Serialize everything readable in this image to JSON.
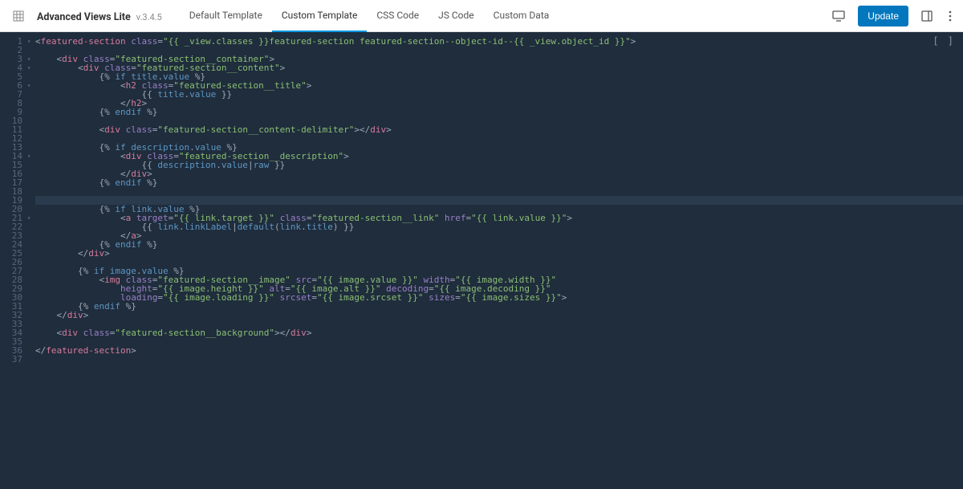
{
  "header": {
    "brand": "Advanced Views Lite",
    "version": "v.3.4.5",
    "update_label": "Update"
  },
  "tabs": [
    {
      "label": "Default Template",
      "active": false
    },
    {
      "label": "Custom Template",
      "active": true
    },
    {
      "label": "CSS Code",
      "active": false
    },
    {
      "label": "JS Code",
      "active": false
    },
    {
      "label": "Custom Data",
      "active": false
    }
  ],
  "editor": {
    "highlighted_line": 19,
    "brackets": "[ ]",
    "lines": [
      {
        "n": 1,
        "fold": "-",
        "tokens": [
          {
            "t": "tdel",
            "v": "<"
          },
          {
            "t": "tag",
            "v": "featured-section"
          },
          {
            "t": "",
            "v": " "
          },
          {
            "t": "attr",
            "v": "class"
          },
          {
            "t": "tpunc",
            "v": "="
          },
          {
            "t": "str",
            "v": "\"{{ _view.classes }}featured-section featured-section--object-id--{{ _view.object_id }}\""
          },
          {
            "t": "tdel",
            "v": ">"
          }
        ]
      },
      {
        "n": 2,
        "fold": "",
        "tokens": []
      },
      {
        "n": 3,
        "fold": "-",
        "tokens": [
          {
            "t": "",
            "v": "    "
          },
          {
            "t": "tdel",
            "v": "<"
          },
          {
            "t": "tag",
            "v": "div"
          },
          {
            "t": "",
            "v": " "
          },
          {
            "t": "attr",
            "v": "class"
          },
          {
            "t": "tpunc",
            "v": "="
          },
          {
            "t": "str",
            "v": "\"featured-section__container\""
          },
          {
            "t": "tdel",
            "v": ">"
          }
        ]
      },
      {
        "n": 4,
        "fold": "-",
        "tokens": [
          {
            "t": "",
            "v": "        "
          },
          {
            "t": "tdel",
            "v": "<"
          },
          {
            "t": "tag",
            "v": "div"
          },
          {
            "t": "",
            "v": " "
          },
          {
            "t": "attr",
            "v": "class"
          },
          {
            "t": "tpunc",
            "v": "="
          },
          {
            "t": "str",
            "v": "\"featured-section__content\""
          },
          {
            "t": "tdel",
            "v": ">"
          }
        ]
      },
      {
        "n": 5,
        "fold": "",
        "tokens": [
          {
            "t": "",
            "v": "            "
          },
          {
            "t": "tdel",
            "v": "{% "
          },
          {
            "t": "tvar",
            "v": "if"
          },
          {
            "t": "",
            "v": " "
          },
          {
            "t": "tvar",
            "v": "title"
          },
          {
            "t": "tpunc",
            "v": "."
          },
          {
            "t": "tvar",
            "v": "value"
          },
          {
            "t": "tdel",
            "v": " %}"
          }
        ]
      },
      {
        "n": 6,
        "fold": "-",
        "tokens": [
          {
            "t": "",
            "v": "                "
          },
          {
            "t": "tdel",
            "v": "<"
          },
          {
            "t": "tag",
            "v": "h2"
          },
          {
            "t": "",
            "v": " "
          },
          {
            "t": "attr",
            "v": "class"
          },
          {
            "t": "tpunc",
            "v": "="
          },
          {
            "t": "str",
            "v": "\"featured-section__title\""
          },
          {
            "t": "tdel",
            "v": ">"
          }
        ]
      },
      {
        "n": 7,
        "fold": "",
        "tokens": [
          {
            "t": "",
            "v": "                    "
          },
          {
            "t": "tdel",
            "v": "{{ "
          },
          {
            "t": "tvar",
            "v": "title"
          },
          {
            "t": "tpunc",
            "v": "."
          },
          {
            "t": "tvar",
            "v": "value"
          },
          {
            "t": "tdel",
            "v": " }}"
          }
        ]
      },
      {
        "n": 8,
        "fold": "",
        "tokens": [
          {
            "t": "",
            "v": "                "
          },
          {
            "t": "tdel",
            "v": "</"
          },
          {
            "t": "tag",
            "v": "h2"
          },
          {
            "t": "tdel",
            "v": ">"
          }
        ]
      },
      {
        "n": 9,
        "fold": "",
        "tokens": [
          {
            "t": "",
            "v": "            "
          },
          {
            "t": "tdel",
            "v": "{% "
          },
          {
            "t": "tvar",
            "v": "endif"
          },
          {
            "t": "tdel",
            "v": " %}"
          }
        ]
      },
      {
        "n": 10,
        "fold": "",
        "tokens": []
      },
      {
        "n": 11,
        "fold": "",
        "tokens": [
          {
            "t": "",
            "v": "            "
          },
          {
            "t": "tdel",
            "v": "<"
          },
          {
            "t": "tag",
            "v": "div"
          },
          {
            "t": "",
            "v": " "
          },
          {
            "t": "attr",
            "v": "class"
          },
          {
            "t": "tpunc",
            "v": "="
          },
          {
            "t": "str",
            "v": "\"featured-section__content-delimiter\""
          },
          {
            "t": "tdel",
            "v": "></"
          },
          {
            "t": "tag",
            "v": "div"
          },
          {
            "t": "tdel",
            "v": ">"
          }
        ]
      },
      {
        "n": 12,
        "fold": "",
        "tokens": []
      },
      {
        "n": 13,
        "fold": "",
        "tokens": [
          {
            "t": "",
            "v": "            "
          },
          {
            "t": "tdel",
            "v": "{% "
          },
          {
            "t": "tvar",
            "v": "if"
          },
          {
            "t": "",
            "v": " "
          },
          {
            "t": "tvar",
            "v": "description"
          },
          {
            "t": "tpunc",
            "v": "."
          },
          {
            "t": "tvar",
            "v": "value"
          },
          {
            "t": "tdel",
            "v": " %}"
          }
        ]
      },
      {
        "n": 14,
        "fold": "-",
        "tokens": [
          {
            "t": "",
            "v": "                "
          },
          {
            "t": "tdel",
            "v": "<"
          },
          {
            "t": "tag",
            "v": "div"
          },
          {
            "t": "",
            "v": " "
          },
          {
            "t": "attr",
            "v": "class"
          },
          {
            "t": "tpunc",
            "v": "="
          },
          {
            "t": "str",
            "v": "\"featured-section__description\""
          },
          {
            "t": "tdel",
            "v": ">"
          }
        ]
      },
      {
        "n": 15,
        "fold": "",
        "tokens": [
          {
            "t": "",
            "v": "                    "
          },
          {
            "t": "tdel",
            "v": "{{ "
          },
          {
            "t": "tvar",
            "v": "description"
          },
          {
            "t": "tpunc",
            "v": "."
          },
          {
            "t": "tvar",
            "v": "value"
          },
          {
            "t": "tpunc",
            "v": "|"
          },
          {
            "t": "tvar",
            "v": "raw"
          },
          {
            "t": "tdel",
            "v": " }}"
          }
        ]
      },
      {
        "n": 16,
        "fold": "",
        "tokens": [
          {
            "t": "",
            "v": "                "
          },
          {
            "t": "tdel",
            "v": "</"
          },
          {
            "t": "tag",
            "v": "div"
          },
          {
            "t": "tdel",
            "v": ">"
          }
        ]
      },
      {
        "n": 17,
        "fold": "",
        "tokens": [
          {
            "t": "",
            "v": "            "
          },
          {
            "t": "tdel",
            "v": "{% "
          },
          {
            "t": "tvar",
            "v": "endif"
          },
          {
            "t": "tdel",
            "v": " %}"
          }
        ]
      },
      {
        "n": 18,
        "fold": "",
        "tokens": []
      },
      {
        "n": 19,
        "fold": "",
        "tokens": []
      },
      {
        "n": 20,
        "fold": "",
        "tokens": [
          {
            "t": "",
            "v": "            "
          },
          {
            "t": "tdel",
            "v": "{% "
          },
          {
            "t": "tvar",
            "v": "if"
          },
          {
            "t": "",
            "v": " "
          },
          {
            "t": "tvar",
            "v": "link"
          },
          {
            "t": "tpunc",
            "v": "."
          },
          {
            "t": "tvar",
            "v": "value"
          },
          {
            "t": "tdel",
            "v": " %}"
          }
        ]
      },
      {
        "n": 21,
        "fold": "-",
        "tokens": [
          {
            "t": "",
            "v": "                "
          },
          {
            "t": "tdel",
            "v": "<"
          },
          {
            "t": "tag",
            "v": "a"
          },
          {
            "t": "",
            "v": " "
          },
          {
            "t": "attr",
            "v": "target"
          },
          {
            "t": "tpunc",
            "v": "="
          },
          {
            "t": "str",
            "v": "\"{{ link.target }}\""
          },
          {
            "t": "",
            "v": " "
          },
          {
            "t": "attr",
            "v": "class"
          },
          {
            "t": "tpunc",
            "v": "="
          },
          {
            "t": "str",
            "v": "\"featured-section__link\""
          },
          {
            "t": "",
            "v": " "
          },
          {
            "t": "attr",
            "v": "href"
          },
          {
            "t": "tpunc",
            "v": "="
          },
          {
            "t": "str",
            "v": "\"{{ link.value }}\""
          },
          {
            "t": "tdel",
            "v": ">"
          }
        ]
      },
      {
        "n": 22,
        "fold": "",
        "tokens": [
          {
            "t": "",
            "v": "                    "
          },
          {
            "t": "tdel",
            "v": "{{ "
          },
          {
            "t": "tvar",
            "v": "link"
          },
          {
            "t": "tpunc",
            "v": "."
          },
          {
            "t": "tvar",
            "v": "linkLabel"
          },
          {
            "t": "tpunc",
            "v": "|"
          },
          {
            "t": "tvar",
            "v": "default"
          },
          {
            "t": "tpunc",
            "v": "("
          },
          {
            "t": "tvar",
            "v": "link"
          },
          {
            "t": "tpunc",
            "v": "."
          },
          {
            "t": "tvar",
            "v": "title"
          },
          {
            "t": "tpunc",
            "v": ")"
          },
          {
            "t": "tdel",
            "v": " }}"
          }
        ]
      },
      {
        "n": 23,
        "fold": "",
        "tokens": [
          {
            "t": "",
            "v": "                "
          },
          {
            "t": "tdel",
            "v": "</"
          },
          {
            "t": "tag",
            "v": "a"
          },
          {
            "t": "tdel",
            "v": ">"
          }
        ]
      },
      {
        "n": 24,
        "fold": "",
        "tokens": [
          {
            "t": "",
            "v": "            "
          },
          {
            "t": "tdel",
            "v": "{% "
          },
          {
            "t": "tvar",
            "v": "endif"
          },
          {
            "t": "tdel",
            "v": " %}"
          }
        ]
      },
      {
        "n": 25,
        "fold": "",
        "tokens": [
          {
            "t": "",
            "v": "        "
          },
          {
            "t": "tdel",
            "v": "</"
          },
          {
            "t": "tag",
            "v": "div"
          },
          {
            "t": "tdel",
            "v": ">"
          }
        ]
      },
      {
        "n": 26,
        "fold": "",
        "tokens": []
      },
      {
        "n": 27,
        "fold": "",
        "tokens": [
          {
            "t": "",
            "v": "        "
          },
          {
            "t": "tdel",
            "v": "{% "
          },
          {
            "t": "tvar",
            "v": "if"
          },
          {
            "t": "",
            "v": " "
          },
          {
            "t": "tvar",
            "v": "image"
          },
          {
            "t": "tpunc",
            "v": "."
          },
          {
            "t": "tvar",
            "v": "value"
          },
          {
            "t": "tdel",
            "v": " %}"
          }
        ]
      },
      {
        "n": 28,
        "fold": "",
        "tokens": [
          {
            "t": "",
            "v": "            "
          },
          {
            "t": "tdel",
            "v": "<"
          },
          {
            "t": "tag",
            "v": "img"
          },
          {
            "t": "",
            "v": " "
          },
          {
            "t": "attr",
            "v": "class"
          },
          {
            "t": "tpunc",
            "v": "="
          },
          {
            "t": "str",
            "v": "\"featured-section__image\""
          },
          {
            "t": "",
            "v": " "
          },
          {
            "t": "attr",
            "v": "src"
          },
          {
            "t": "tpunc",
            "v": "="
          },
          {
            "t": "str",
            "v": "\"{{ image.value }}\""
          },
          {
            "t": "",
            "v": " "
          },
          {
            "t": "attr",
            "v": "width"
          },
          {
            "t": "tpunc",
            "v": "="
          },
          {
            "t": "str",
            "v": "\"{{ image.width }}\""
          }
        ]
      },
      {
        "n": 29,
        "fold": "",
        "tokens": [
          {
            "t": "",
            "v": "                "
          },
          {
            "t": "attr",
            "v": "height"
          },
          {
            "t": "tpunc",
            "v": "="
          },
          {
            "t": "str",
            "v": "\"{{ image.height }}\""
          },
          {
            "t": "",
            "v": " "
          },
          {
            "t": "attr",
            "v": "alt"
          },
          {
            "t": "tpunc",
            "v": "="
          },
          {
            "t": "str",
            "v": "\"{{ image.alt }}\""
          },
          {
            "t": "",
            "v": " "
          },
          {
            "t": "attr",
            "v": "decoding"
          },
          {
            "t": "tpunc",
            "v": "="
          },
          {
            "t": "str",
            "v": "\"{{ image.decoding }}\""
          }
        ]
      },
      {
        "n": 30,
        "fold": "",
        "tokens": [
          {
            "t": "",
            "v": "                "
          },
          {
            "t": "attr",
            "v": "loading"
          },
          {
            "t": "tpunc",
            "v": "="
          },
          {
            "t": "str",
            "v": "\"{{ image.loading }}\""
          },
          {
            "t": "",
            "v": " "
          },
          {
            "t": "attr",
            "v": "srcset"
          },
          {
            "t": "tpunc",
            "v": "="
          },
          {
            "t": "str",
            "v": "\"{{ image.srcset }}\""
          },
          {
            "t": "",
            "v": " "
          },
          {
            "t": "attr",
            "v": "sizes"
          },
          {
            "t": "tpunc",
            "v": "="
          },
          {
            "t": "str",
            "v": "\"{{ image.sizes }}\""
          },
          {
            "t": "tdel",
            "v": ">"
          }
        ]
      },
      {
        "n": 31,
        "fold": "",
        "tokens": [
          {
            "t": "",
            "v": "        "
          },
          {
            "t": "tdel",
            "v": "{% "
          },
          {
            "t": "tvar",
            "v": "endif"
          },
          {
            "t": "tdel",
            "v": " %}"
          }
        ]
      },
      {
        "n": 32,
        "fold": "",
        "tokens": [
          {
            "t": "",
            "v": "    "
          },
          {
            "t": "tdel",
            "v": "</"
          },
          {
            "t": "tag",
            "v": "div"
          },
          {
            "t": "tdel",
            "v": ">"
          }
        ]
      },
      {
        "n": 33,
        "fold": "",
        "tokens": []
      },
      {
        "n": 34,
        "fold": "",
        "tokens": [
          {
            "t": "",
            "v": "    "
          },
          {
            "t": "tdel",
            "v": "<"
          },
          {
            "t": "tag",
            "v": "div"
          },
          {
            "t": "",
            "v": " "
          },
          {
            "t": "attr",
            "v": "class"
          },
          {
            "t": "tpunc",
            "v": "="
          },
          {
            "t": "str",
            "v": "\"featured-section__background\""
          },
          {
            "t": "tdel",
            "v": "></"
          },
          {
            "t": "tag",
            "v": "div"
          },
          {
            "t": "tdel",
            "v": ">"
          }
        ]
      },
      {
        "n": 35,
        "fold": "",
        "tokens": []
      },
      {
        "n": 36,
        "fold": "",
        "tokens": [
          {
            "t": "tdel",
            "v": "</"
          },
          {
            "t": "tag",
            "v": "featured-section"
          },
          {
            "t": "tdel",
            "v": ">"
          }
        ]
      },
      {
        "n": 37,
        "fold": "",
        "tokens": []
      }
    ]
  }
}
